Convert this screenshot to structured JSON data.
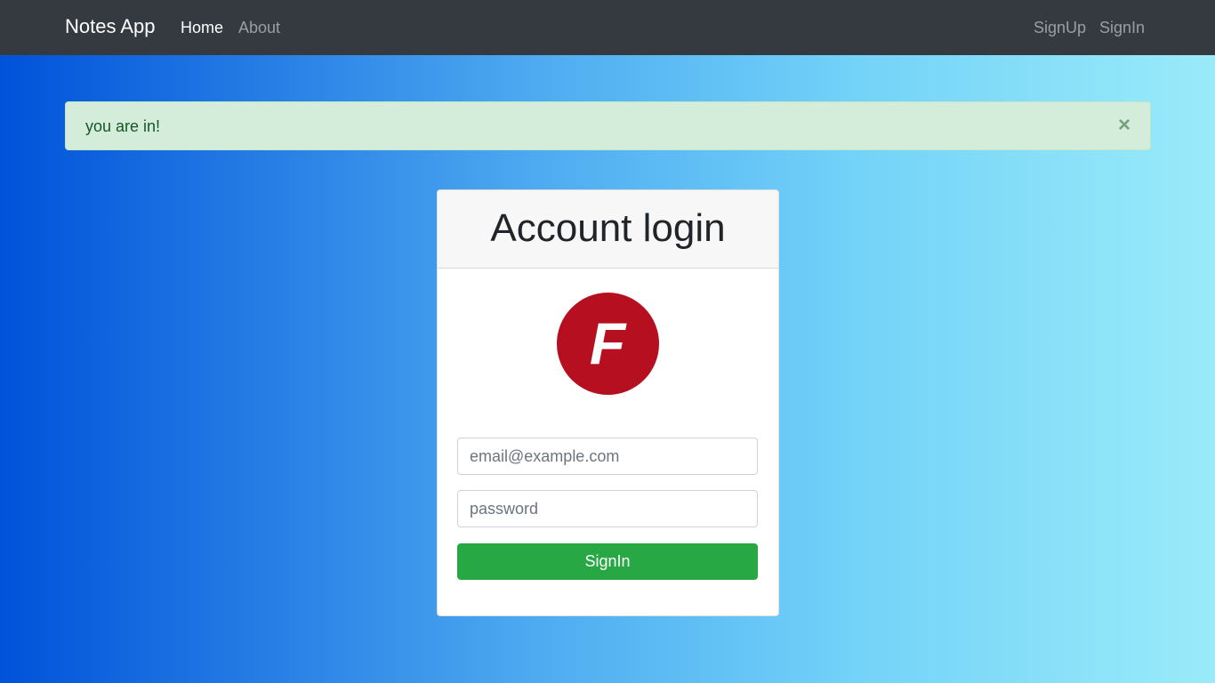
{
  "navbar": {
    "brand": "Notes App",
    "links": [
      {
        "label": "Home",
        "active": true
      },
      {
        "label": "About",
        "active": false
      }
    ],
    "right_links": [
      {
        "label": "SignUp"
      },
      {
        "label": "SignIn"
      }
    ]
  },
  "alert": {
    "message": "you are in!",
    "close_symbol": "×",
    "color": "#d4edda"
  },
  "login_card": {
    "title": "Account login",
    "logo_icon": "letter-f-logo-icon",
    "logo_letter": "F",
    "logo_color": "#b50f20",
    "email": {
      "value": "",
      "placeholder": "email@example.com"
    },
    "password": {
      "value": "",
      "placeholder": "password"
    },
    "submit_label": "SignIn",
    "submit_color": "#28a745"
  }
}
